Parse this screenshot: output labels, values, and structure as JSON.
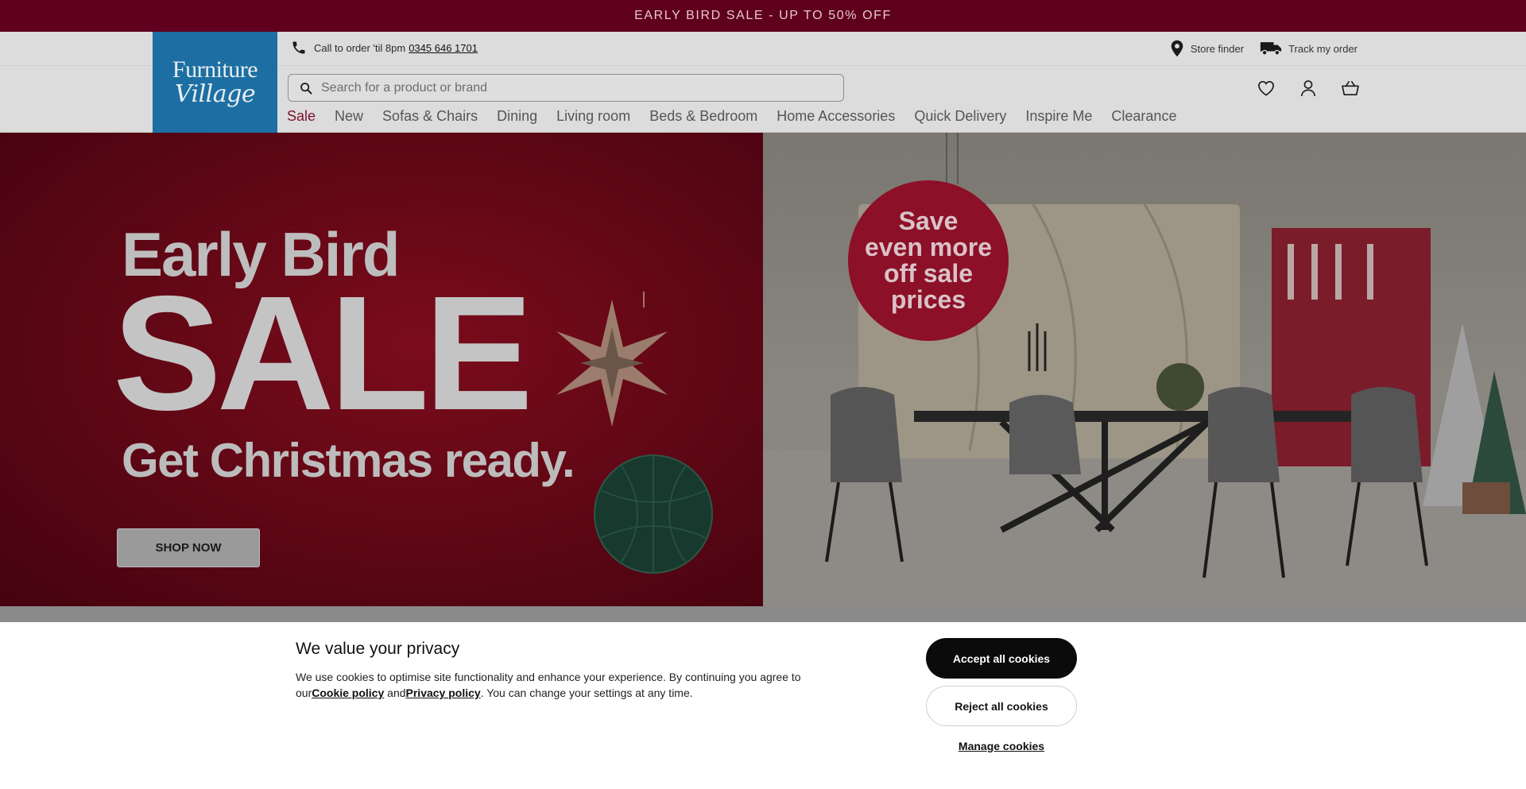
{
  "promo_banner": {
    "text": "EARLY BIRD SALE - UP TO 50% OFF"
  },
  "utility_bar": {
    "call_text": "Call to order 'til 8pm",
    "phone_number": "0345 646 1701",
    "store_finder": "Store finder",
    "track_order": "Track my order"
  },
  "logo": {
    "line1": "Furniture",
    "line2": "Village"
  },
  "search": {
    "placeholder": "Search for a product or brand"
  },
  "header_icons": [
    "heart-icon",
    "account-icon",
    "basket-icon"
  ],
  "nav": {
    "items": [
      {
        "label": "Sale"
      },
      {
        "label": "New"
      },
      {
        "label": "Sofas & Chairs"
      },
      {
        "label": "Dining"
      },
      {
        "label": "Living room"
      },
      {
        "label": "Beds & Bedroom"
      },
      {
        "label": "Home Accessories"
      },
      {
        "label": "Quick Delivery"
      },
      {
        "label": "Inspire Me"
      },
      {
        "label": "Clearance"
      }
    ]
  },
  "hero": {
    "line1": "Early Bird",
    "line2": "SALE",
    "line3": "Get Christmas ready.",
    "cta": "SHOP NOW",
    "badge": [
      "Save",
      "even more",
      "off sale",
      "prices"
    ]
  },
  "cookie": {
    "title": "We value your privacy",
    "text_part1": "We use cookies to optimise site functionality and enhance your experience. By continuing you agree to our",
    "cookie_policy_link": "Cookie policy",
    "text_and": " and",
    "privacy_policy_link": "Privacy policy",
    "text_part2": ". You can change your settings at any time.",
    "accept_label": "Accept all cookies",
    "reject_label": "Reject all cookies",
    "manage_label": "Manage cookies"
  },
  "colors": {
    "promo_bg": "#5f001e",
    "logo_bg": "#1d6fa3",
    "sale_nav": "#7e1230",
    "accept_bg": "#0b0b0b"
  }
}
